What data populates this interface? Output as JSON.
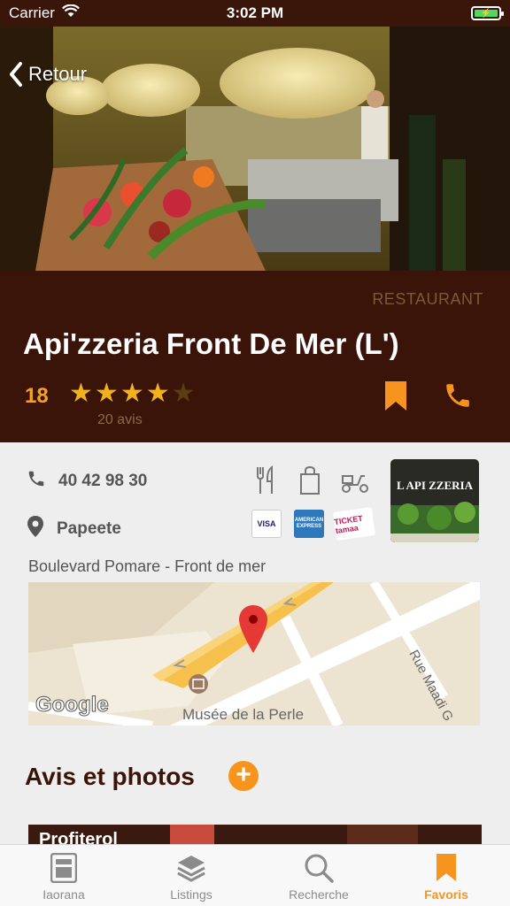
{
  "status_bar": {
    "carrier": "Carrier",
    "time": "3:02 PM"
  },
  "nav": {
    "back_label": "Retour"
  },
  "restaurant": {
    "category": "RESTAURANT",
    "name": "Api'zzeria Front De Mer (L')",
    "score": "18",
    "rating": 4,
    "rating_max": 5,
    "reviews_count": "20 avis",
    "phone": "40 42 98 30",
    "city": "Papeete",
    "address": "Boulevard Pomare - Front de mer",
    "thumbnail_text": "L API ZZERIA"
  },
  "services": [
    "utensils-icon",
    "shopping-bag-icon",
    "delivery-scooter-icon"
  ],
  "payment_methods": {
    "visa": "VISA",
    "amex": "AMERICAN EXPRESS",
    "ticket": "TICKET tamaa"
  },
  "map": {
    "street_label": "Rue Maadi G",
    "poi_label": "Musée de la Perle",
    "provider": "Google"
  },
  "reviews_section": {
    "title": "Avis et photos",
    "add_symbol": "+",
    "first_card_title": "Profiterol"
  },
  "tabs": [
    {
      "label": "Iaorana",
      "icon": "news-icon",
      "active": false
    },
    {
      "label": "Listings",
      "icon": "layers-icon",
      "active": false
    },
    {
      "label": "Recherche",
      "icon": "search-icon",
      "active": false
    },
    {
      "label": "Favoris",
      "icon": "bookmark-icon",
      "active": true
    }
  ],
  "colors": {
    "accent": "#f7941d",
    "header_brown": "#3a1408",
    "star": "#f2b31a"
  }
}
